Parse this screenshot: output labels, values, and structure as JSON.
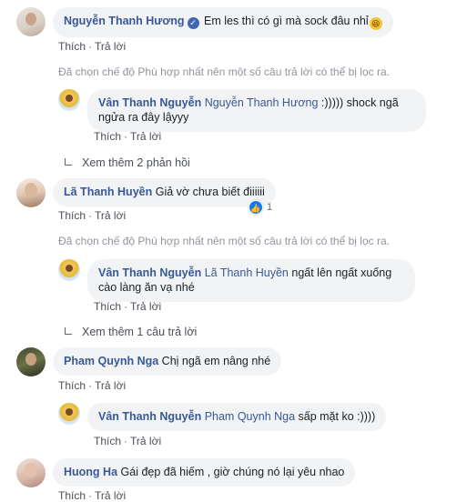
{
  "comments": [
    {
      "name": "Nguyễn Thanh Hương",
      "verified": true,
      "text": "Em les thì có gì mà sock đâu nhỉ",
      "emoji": "grin-emoji",
      "like": "Thích",
      "reply": "Trả lời",
      "notice": "Đã chọn chế độ Phù hợp nhất nên một số câu trả lời có thể bị lọc ra.",
      "replies": [
        {
          "name": "Vân Thanh Nguyễn",
          "tag": "Nguyễn Thanh Hương",
          "text_line1": " :))))) shock ngã",
          "text_line2": "ngửa ra đây lậyyy",
          "like": "Thích",
          "reply": "Trả lời"
        }
      ],
      "more": "Xem thêm 2 phản hồi"
    },
    {
      "name": "Lã Thanh Huyền",
      "text": "Giả vờ chưa biết điiiiii",
      "like": "Thích",
      "reply": "Trả lời",
      "reaction_count": "1",
      "notice": "Đã chọn chế độ Phù hợp nhất nên một số câu trả lời có thể bị lọc ra.",
      "replies": [
        {
          "name": "Vân Thanh Nguyễn",
          "tag": "Lã Thanh Huyền",
          "text_line1": " ngất lên ngất xuống",
          "text_line2": "cào làng ăn vạ nhé",
          "like": "Thích",
          "reply": "Trả lời"
        }
      ],
      "more": "Xem thêm 1 câu trả lời"
    },
    {
      "name": "Pham Quynh Nga",
      "text": "Chị ngã em nâng nhé",
      "like": "Thích",
      "reply": "Trả lời",
      "replies": [
        {
          "name": "Vân Thanh Nguyễn",
          "tag": "Pham Quynh Nga",
          "text_line1": " sấp mặt ko :))))",
          "like": "Thích",
          "reply": "Trả lời"
        }
      ]
    },
    {
      "name": "Huong Ha",
      "text": "Gái đẹp đã hiếm , giờ chúng nó lại yêu nhao",
      "like": "Thích",
      "reply": "Trả lời"
    }
  ],
  "colors": {
    "name": "#385898",
    "bubble": "#f2f3f5",
    "meta": "#606770",
    "notice": "#90949c",
    "like_badge": "#1877f2"
  }
}
